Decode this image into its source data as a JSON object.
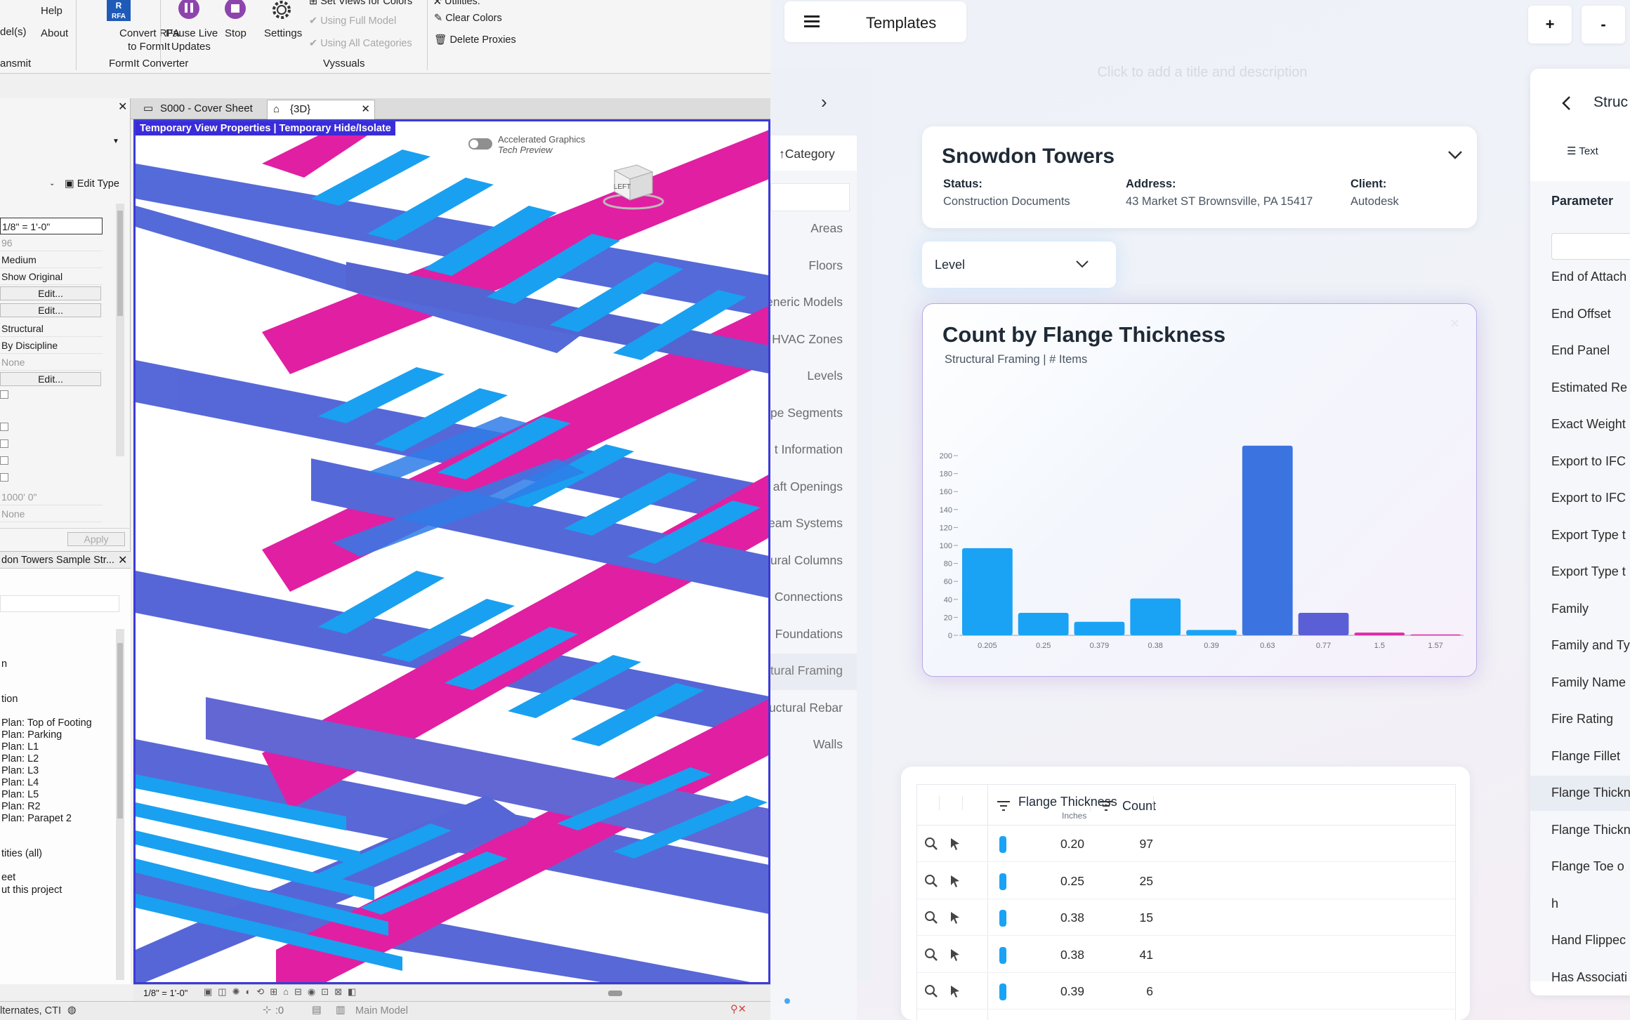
{
  "revit": {
    "ribbon": {
      "models_label": "del(s)",
      "help_label": "Help",
      "about_label": "About",
      "convert_label_1": "Convert RFA",
      "convert_label_2": "to FormIt",
      "rfa_badge": "RFA",
      "pause_label_1": "Pause Live",
      "pause_label_2": "Updates",
      "stop_label": "Stop",
      "settings_label": "Settings",
      "vyssuals_items": [
        "Set Views for Colors",
        "Using Full Model",
        "Using All Categories"
      ],
      "utilities_items": [
        "Utilities:",
        "Clear Colors",
        "Delete Proxies"
      ],
      "panel_transmit": "ansmit",
      "panel_formit": "FormIt Converter",
      "panel_vyssuals": "Vyssuals"
    },
    "tabs": [
      {
        "label": "S000 - Cover Sheet",
        "active": false
      },
      {
        "label": "{3D}",
        "active": true
      }
    ],
    "viewport": {
      "temp_banner": "Temporary View Properties | Temporary Hide/Isolate",
      "accel_label_1": "Accelerated Graphics",
      "accel_label_2": "Tech Preview",
      "viewcube_label": "LEFT"
    },
    "properties": {
      "edit_type_label": "Edit Type",
      "scale_value": "1/8\" = 1'-0\"",
      "rows": [
        "96",
        "Medium",
        "Show Original",
        "Edit...",
        "Edit...",
        "Structural",
        "By Discipline",
        "None",
        "Edit..."
      ],
      "lower_rows": [
        "1000' 0\"",
        "None"
      ],
      "apply_label": "Apply"
    },
    "browser": {
      "title": "don Towers Sample Str...",
      "items": [
        "n",
        "tion",
        "Plan: Top of Footing",
        "Plan: Parking",
        "Plan: L1",
        "Plan: L2",
        "Plan: L3",
        "Plan: L4",
        "Plan: L5",
        "Plan: R2",
        "Plan: Parapet 2",
        "tities (all)",
        "eet",
        "ut this project"
      ]
    },
    "view_scale": "1/8\" = 1'-0\"",
    "status": {
      "left_text": "lternates, CTI",
      "zero_count": ":0",
      "model": "Main Model"
    }
  },
  "app": {
    "title": "Templates",
    "plus_label": "+",
    "minus_label": "-",
    "hint": "Click to add a title and description",
    "sidebar": {
      "header": "Category",
      "items": [
        "Areas",
        "Floors",
        "eneric Models",
        "HVAC Zones",
        "Levels",
        "pe Segments",
        "t Information",
        "aft Openings",
        "eam Systems",
        "ural Columns",
        "Connections",
        "Foundations",
        "tural Framing",
        "uctural Rebar",
        "Walls"
      ],
      "selected_index": 12
    },
    "project": {
      "name": "Snowdon Towers",
      "status_label": "Status:",
      "status_value": "Construction Documents",
      "address_label": "Address:",
      "address_value": "43 Market ST Brownsville, PA 15417",
      "client_label": "Client:",
      "client_value": "Autodesk"
    },
    "group_by": "Level",
    "chart_data": {
      "type": "bar",
      "title": "Count by Flange Thickness",
      "subtitle": "Structural Framing | # Items",
      "categories": [
        "0.205",
        "0.25",
        "0.379",
        "0.38",
        "0.39",
        "0.63",
        "0.77",
        "1.5",
        "1.57"
      ],
      "values": [
        97,
        25,
        15,
        41,
        6,
        211,
        25,
        3,
        1
      ],
      "colors": [
        "#1aa3f5",
        "#1aa3f5",
        "#1aa3f5",
        "#1aa3f5",
        "#1aa3f5",
        "#3b74e0",
        "#5b5fd6",
        "#dd2ca7",
        "#dd2ca7"
      ],
      "y_ticks": [
        "0",
        "20",
        "40",
        "60",
        "80",
        "100",
        "120",
        "140",
        "160",
        "180",
        "200"
      ],
      "ylim": [
        0,
        211
      ]
    },
    "table": {
      "col_thickness": "Flange Thickness",
      "col_thickness_unit": "Inches",
      "col_count": "Count",
      "rows": [
        {
          "thickness": "0.20",
          "count": "97",
          "color": "#1aa3f5"
        },
        {
          "thickness": "0.25",
          "count": "25",
          "color": "#1aa3f5"
        },
        {
          "thickness": "0.38",
          "count": "15",
          "color": "#1aa3f5"
        },
        {
          "thickness": "0.38",
          "count": "41",
          "color": "#1aa3f5"
        },
        {
          "thickness": "0.39",
          "count": "6",
          "color": "#1aa3f5"
        }
      ]
    },
    "params": {
      "title": "Struc",
      "text_tab": "Text",
      "header": "Parameter",
      "items": [
        "End of Attach",
        "End Offset",
        "End Panel",
        "Estimated Re",
        "Exact Weight",
        "Export to IFC",
        "Export to IFC",
        "Export Type t",
        "Export Type t",
        "Family",
        "Family and Ty",
        "Family Name",
        "Fire Rating",
        "Flange Fillet",
        "Flange Thickn",
        "Flange Thickn",
        "Flange Toe o",
        "h",
        "Hand Flippec",
        "Has Associati"
      ],
      "selected_index": 14
    }
  }
}
